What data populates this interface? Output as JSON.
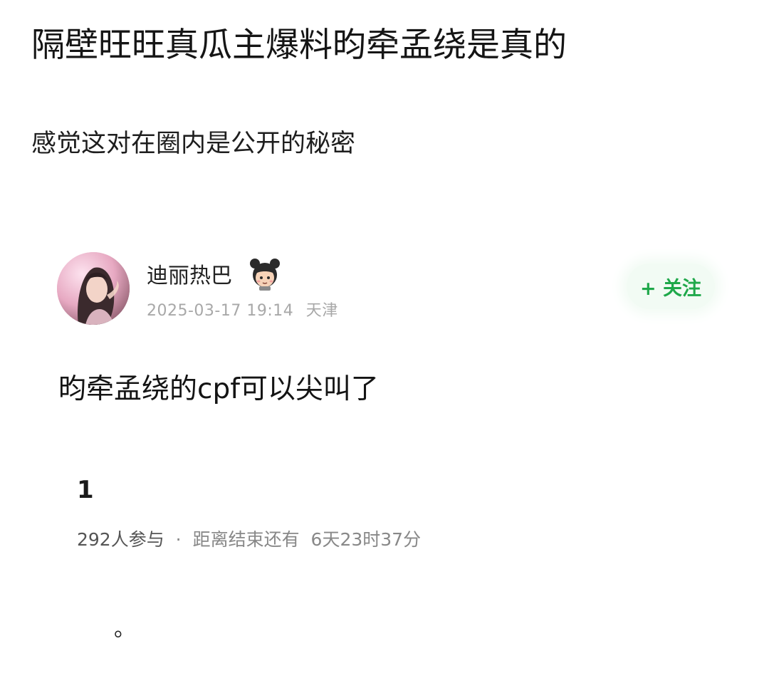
{
  "headline": "隔壁旺旺真瓜主爆料昀牵孟绕是真的",
  "subline": "感觉这对在圈内是公开的秘密",
  "post": {
    "author": "迪丽热巴",
    "badge_icon": "cartoon-girl-emoji-icon",
    "timestamp": "2025-03-17 19:14",
    "location": "天津",
    "follow_label": "+ 关注",
    "body": "昀牵孟绕的cpf可以尖叫了"
  },
  "poll": {
    "count": "1",
    "participants": "292人参与",
    "separator": "·",
    "countdown_prefix": "距离结束还有",
    "countdown": "6天23时37分"
  },
  "trailing_text": "。",
  "colors": {
    "follow_green": "#1fa84a",
    "follow_bg": "#f2fbf4",
    "meta_gray": "#a8a8a8"
  }
}
